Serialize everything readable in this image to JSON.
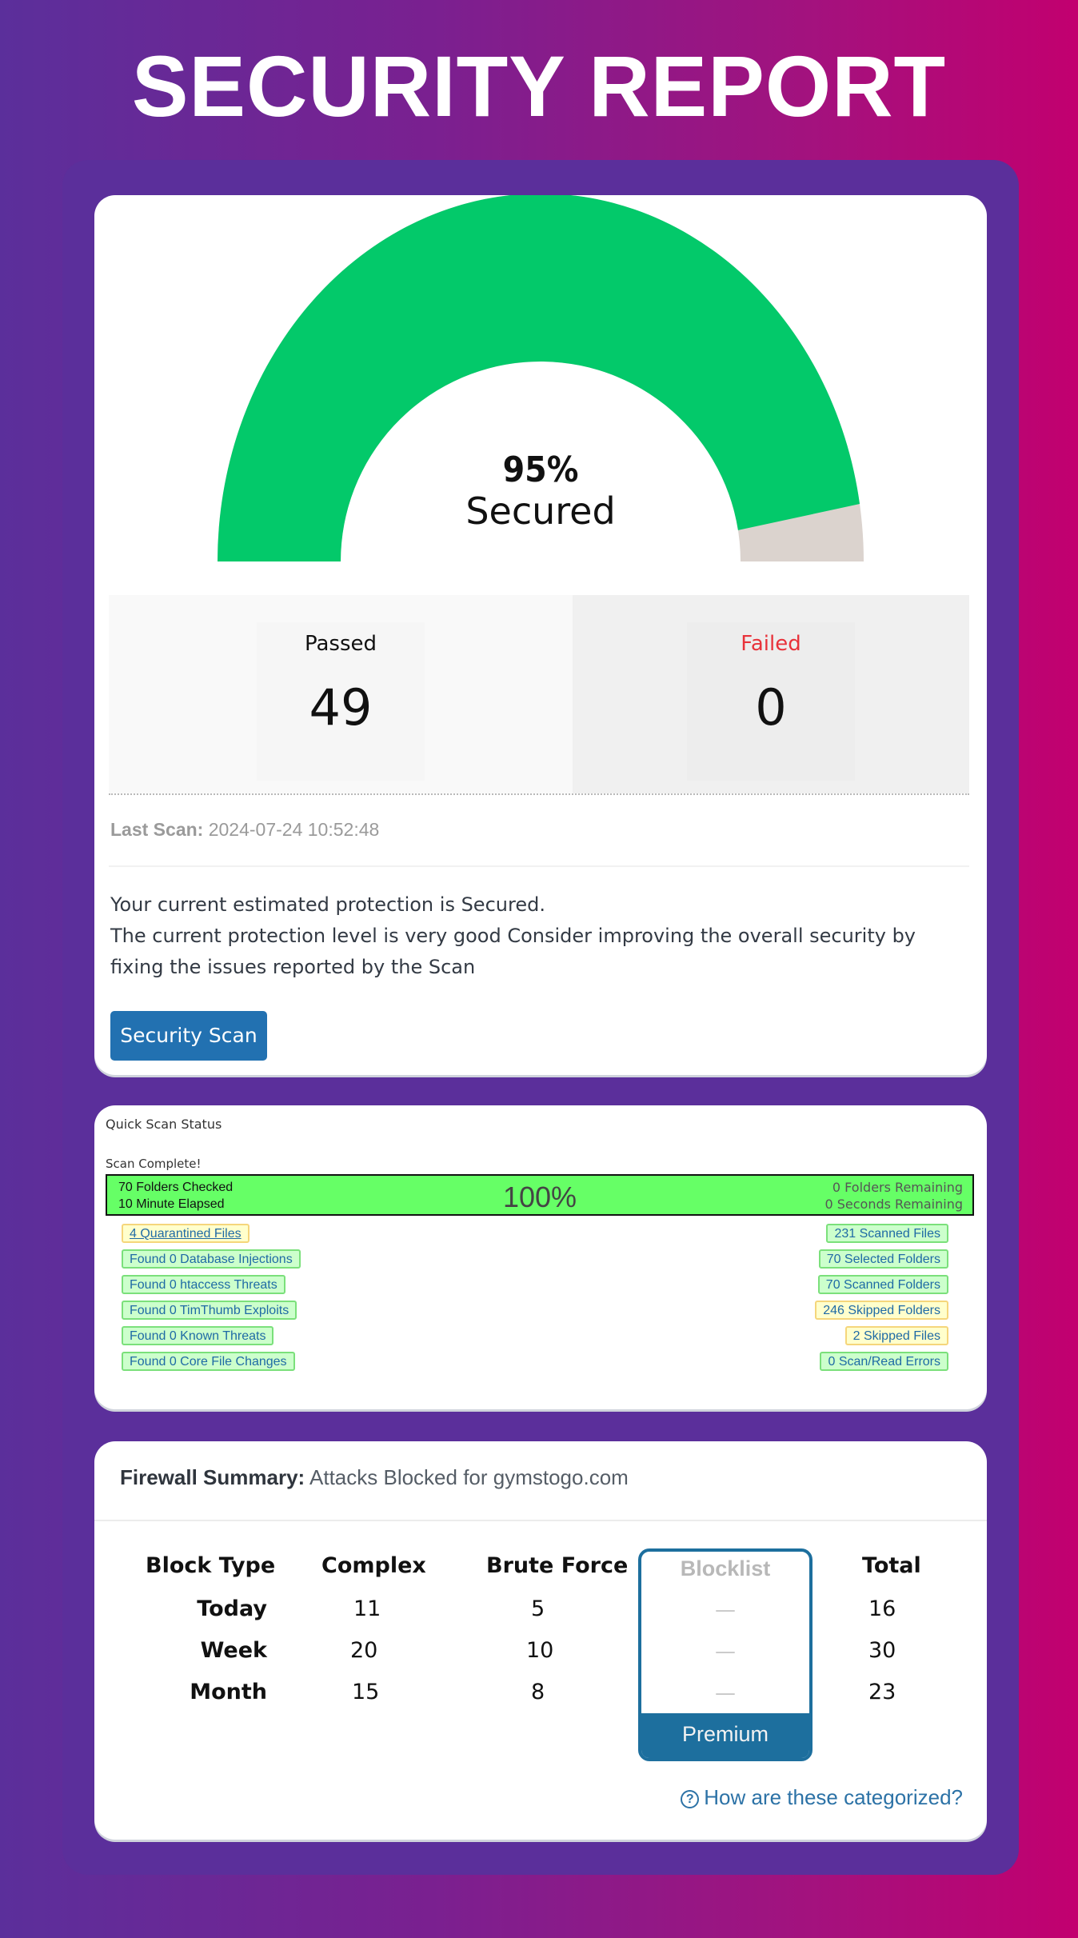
{
  "header": {
    "title": "SECURITY REPORT"
  },
  "gauge": {
    "percent_secured": 95,
    "percent_label": "95%",
    "status_label": "Secured",
    "colors": {
      "secured": "#03c96a",
      "remaining": "#dbd3ce"
    }
  },
  "stats": {
    "passed": {
      "label": "Passed",
      "value": "49"
    },
    "failed": {
      "label": "Failed",
      "value": "0",
      "label_color": "#e8323a"
    }
  },
  "last_scan": {
    "label": "Last Scan:",
    "value": "2024-07-24 10:52:48"
  },
  "description": {
    "line1": "Your current estimated protection is Secured.",
    "line2": "The current protection level is very good Consider improving the overall security by fixing the issues reported by the Scan"
  },
  "security_scan_button": "Security Scan",
  "quick_scan": {
    "title": "Quick Scan Status",
    "status": "Scan Complete!",
    "progress": {
      "percent": 100,
      "percent_label": "100%",
      "folders_checked": "70 Folders Checked",
      "elapsed": "10 Minute Elapsed",
      "folders_remaining": "0 Folders Remaining",
      "seconds_remaining": "0 Seconds Remaining"
    },
    "left_badges": [
      {
        "text": "4 Quarantined Files",
        "type": "warn",
        "link": true
      },
      {
        "text": "Found 0 Database Injections",
        "type": "ok"
      },
      {
        "text": "Found 0 htaccess Threats",
        "type": "ok"
      },
      {
        "text": "Found 0 TimThumb Exploits",
        "type": "ok"
      },
      {
        "text": "Found 0 Known Threats",
        "type": "ok"
      },
      {
        "text": "Found 0 Core File Changes",
        "type": "ok"
      }
    ],
    "right_badges": [
      {
        "text": "231 Scanned Files",
        "type": "ok"
      },
      {
        "text": "70 Selected Folders",
        "type": "ok"
      },
      {
        "text": "70 Scanned Folders",
        "type": "ok"
      },
      {
        "text": "246 Skipped Folders",
        "type": "warn"
      },
      {
        "text": "2 Skipped Files",
        "type": "warn"
      },
      {
        "text": "0 Scan/Read Errors",
        "type": "ok"
      }
    ]
  },
  "firewall": {
    "title_bold": "Firewall Summary:",
    "title_rest": "Attacks Blocked for gymstogo.com",
    "columns": [
      "Block Type",
      "Complex",
      "Brute Force",
      "Blocklist",
      "Total"
    ],
    "rows": [
      {
        "label": "Today",
        "complex": "11",
        "brute_force": "5",
        "blocklist": "—",
        "total": "16"
      },
      {
        "label": "Week",
        "complex": "20",
        "brute_force": "10",
        "blocklist": "—",
        "total": "30"
      },
      {
        "label": "Month",
        "complex": "15",
        "brute_force": "8",
        "blocklist": "—",
        "total": "23"
      }
    ],
    "premium_label": "Premium",
    "help_link": "How are these categorized?"
  }
}
